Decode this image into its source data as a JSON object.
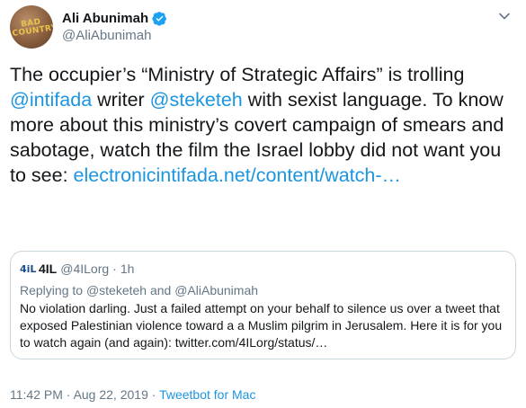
{
  "author": {
    "name": "Ali Abunimah",
    "handle": "@AliAbunimah",
    "avatar_text": "BAD COUNTRY",
    "verified": true
  },
  "tweet": {
    "text_1": "The occupier’s “Ministry of Strategic Affairs” is trolling ",
    "mention_1": "@intifada",
    "text_2": " writer ",
    "mention_2": "@steketeh",
    "text_3": " with sexist language. To know more about this ministry’s covert campaign of smears and sabotage, watch the film the Israel lobby did not want you to see: ",
    "link": "electronicintifada.net/content/watch-…"
  },
  "quote": {
    "logo": "4iL",
    "name": "4IL",
    "handle": "@4ILorg",
    "separator": "·",
    "time": "1h",
    "replying_prefix": "Replying to ",
    "replying_to_1": "@steketeh",
    "replying_and": " and ",
    "replying_to_2": "@AliAbunimah",
    "text": "No violation darling. Just a failed attempt on your behalf to silence us over a tweet that exposed Palestinian violence toward a a Muslim pilgrim in Jerusalem. Here it is for you to watch again (and again): twitter.com/4ILorg/status/…"
  },
  "meta": {
    "time": "11:42 PM",
    "sep1": " · ",
    "date": "Aug 22, 2019",
    "sep2": " · ",
    "source": "Tweetbot for Mac"
  },
  "colors": {
    "link": "#1b95e0",
    "secondary": "#657786",
    "border": "#ccd6dd"
  }
}
